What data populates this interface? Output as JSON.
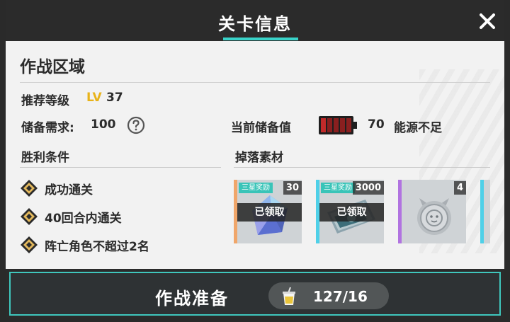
{
  "header": {
    "title": "关卡信息",
    "close_icon": "close-icon"
  },
  "area": {
    "title": "作战区域"
  },
  "level": {
    "label": "推荐等级",
    "prefix": "LV",
    "value": "37"
  },
  "reserve": {
    "label": "储备需求:",
    "value": "100",
    "help_icon": "question-circle-icon"
  },
  "current": {
    "label": "当前储备值",
    "value": "70",
    "status": "能源不足",
    "battery_icon": "battery-low-icon"
  },
  "victory": {
    "label": "胜利条件",
    "conditions": [
      "成功通关",
      "40回合内通关",
      "阵亡角色不超过2名"
    ]
  },
  "drops": {
    "label": "掉落素材",
    "items": [
      {
        "badge": "三星奖励",
        "count": "30",
        "status": "已领取",
        "icon": "blue-crystal-icon",
        "edge_color": "#f0a66a"
      },
      {
        "badge": "三星奖励",
        "count": "3000",
        "status": "已领取",
        "icon": "credit-ticket-icon",
        "edge_color": "#4fd0e8"
      },
      {
        "badge": "",
        "count": "4",
        "status": "",
        "icon": "silver-cat-coin-icon",
        "edge_color": "#b173e0"
      },
      {
        "badge": "",
        "count": "",
        "status": "",
        "icon": "partial-item-icon",
        "edge_color": "#4fd0e8"
      }
    ]
  },
  "battle": {
    "label": "作战准备",
    "stamina": "127/16",
    "stamina_icon": "drink-cup-icon",
    "accent": "#3fc7bd"
  }
}
